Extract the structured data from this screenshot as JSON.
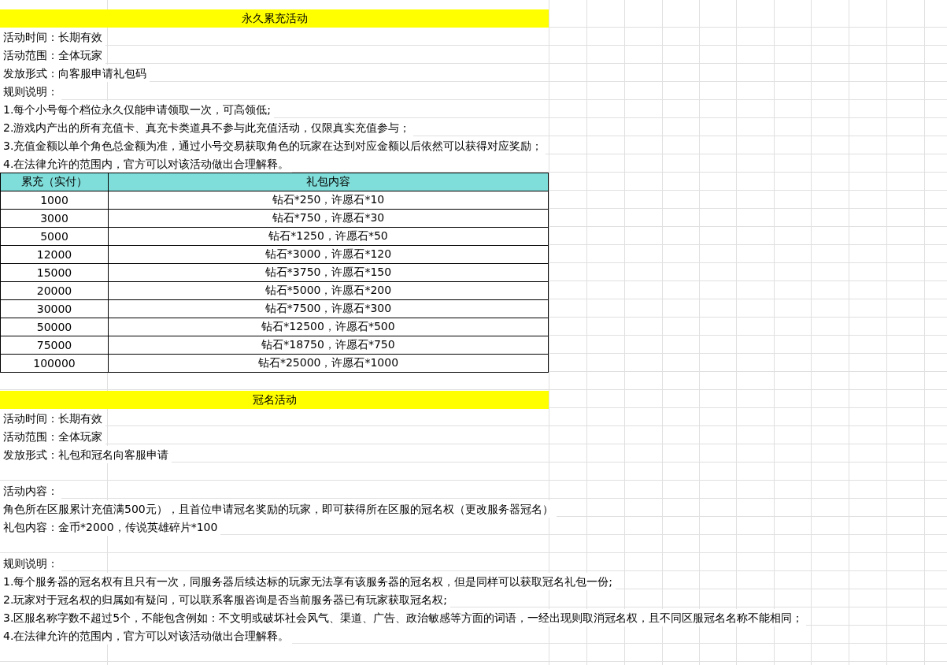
{
  "sections": [
    {
      "title": "永久累充活动",
      "lines": [
        {
          "kind": "text",
          "text": "活动时间：长期有效"
        },
        {
          "kind": "text",
          "text": "活动范围：全体玩家"
        },
        {
          "kind": "text",
          "text": "发放形式：向客服申请礼包码"
        },
        {
          "kind": "text",
          "text": "规则说明："
        },
        {
          "kind": "text",
          "text": "1.每个小号每个档位永久仅能申请领取一次，可高领低;"
        },
        {
          "kind": "text",
          "text": "2.游戏内产出的所有充值卡、真充卡类道具不参与此充值活动，仅限真实充值参与；"
        },
        {
          "kind": "text",
          "text": "3.充值金额以单个角色总金额为准，通过小号交易获取角色的玩家在达到对应金额以后依然可以获得对应奖励；"
        },
        {
          "kind": "text",
          "text": "4.在法律允许的范围内，官方可以对该活动做出合理解释。"
        }
      ],
      "table": {
        "columns": [
          "累充（实付）",
          "礼包内容"
        ],
        "rows": [
          [
            "1000",
            "钻石*250，许愿石*10"
          ],
          [
            "3000",
            "钻石*750，许愿石*30"
          ],
          [
            "5000",
            "钻石*1250，许愿石*50"
          ],
          [
            "12000",
            "钻石*3000，许愿石*120"
          ],
          [
            "15000",
            "钻石*3750，许愿石*150"
          ],
          [
            "20000",
            "钻石*5000，许愿石*200"
          ],
          [
            "30000",
            "钻石*7500，许愿石*300"
          ],
          [
            "50000",
            "钻石*12500，许愿石*500"
          ],
          [
            "75000",
            "钻石*18750，许愿石*750"
          ],
          [
            "100000",
            "钻石*25000，许愿石*1000"
          ]
        ]
      }
    },
    {
      "title": "冠名活动",
      "lines": [
        {
          "kind": "text",
          "text": "活动时间：长期有效"
        },
        {
          "kind": "text",
          "text": "活动范围：全体玩家"
        },
        {
          "kind": "text",
          "text": "发放形式：礼包和冠名向客服申请"
        },
        {
          "kind": "blank"
        },
        {
          "kind": "text",
          "text": "活动内容："
        },
        {
          "kind": "text",
          "text": "角色所在区服累计充值满500元），且首位申请冠名奖励的玩家，即可获得所在区服的冠名权（更改服务器冠名）"
        },
        {
          "kind": "text",
          "text": "礼包内容：金币*2000，传说英雄碎片*100"
        },
        {
          "kind": "blank"
        },
        {
          "kind": "text",
          "text": "规则说明："
        },
        {
          "kind": "text",
          "text": "1.每个服务器的冠名权有且只有一次，同服务器后续达标的玩家无法享有该服务器的冠名权，但是同样可以获取冠名礼包一份;"
        },
        {
          "kind": "text",
          "text": "2.玩家对于冠名权的归属如有疑问，可以联系客服咨询是否当前服务器已有玩家获取冠名权;"
        },
        {
          "kind": "text",
          "text": "3.区服名称字数不超过5个，不能包含例如：不文明或破坏社会风气、渠道、广告、政治敏感等方面的词语，一经出现则取消冠名权，且不同区服冠名名称不能相同；"
        },
        {
          "kind": "text",
          "text": "4.在法律允许的范围内，官方可以对该活动做出合理解释。"
        }
      ]
    }
  ]
}
